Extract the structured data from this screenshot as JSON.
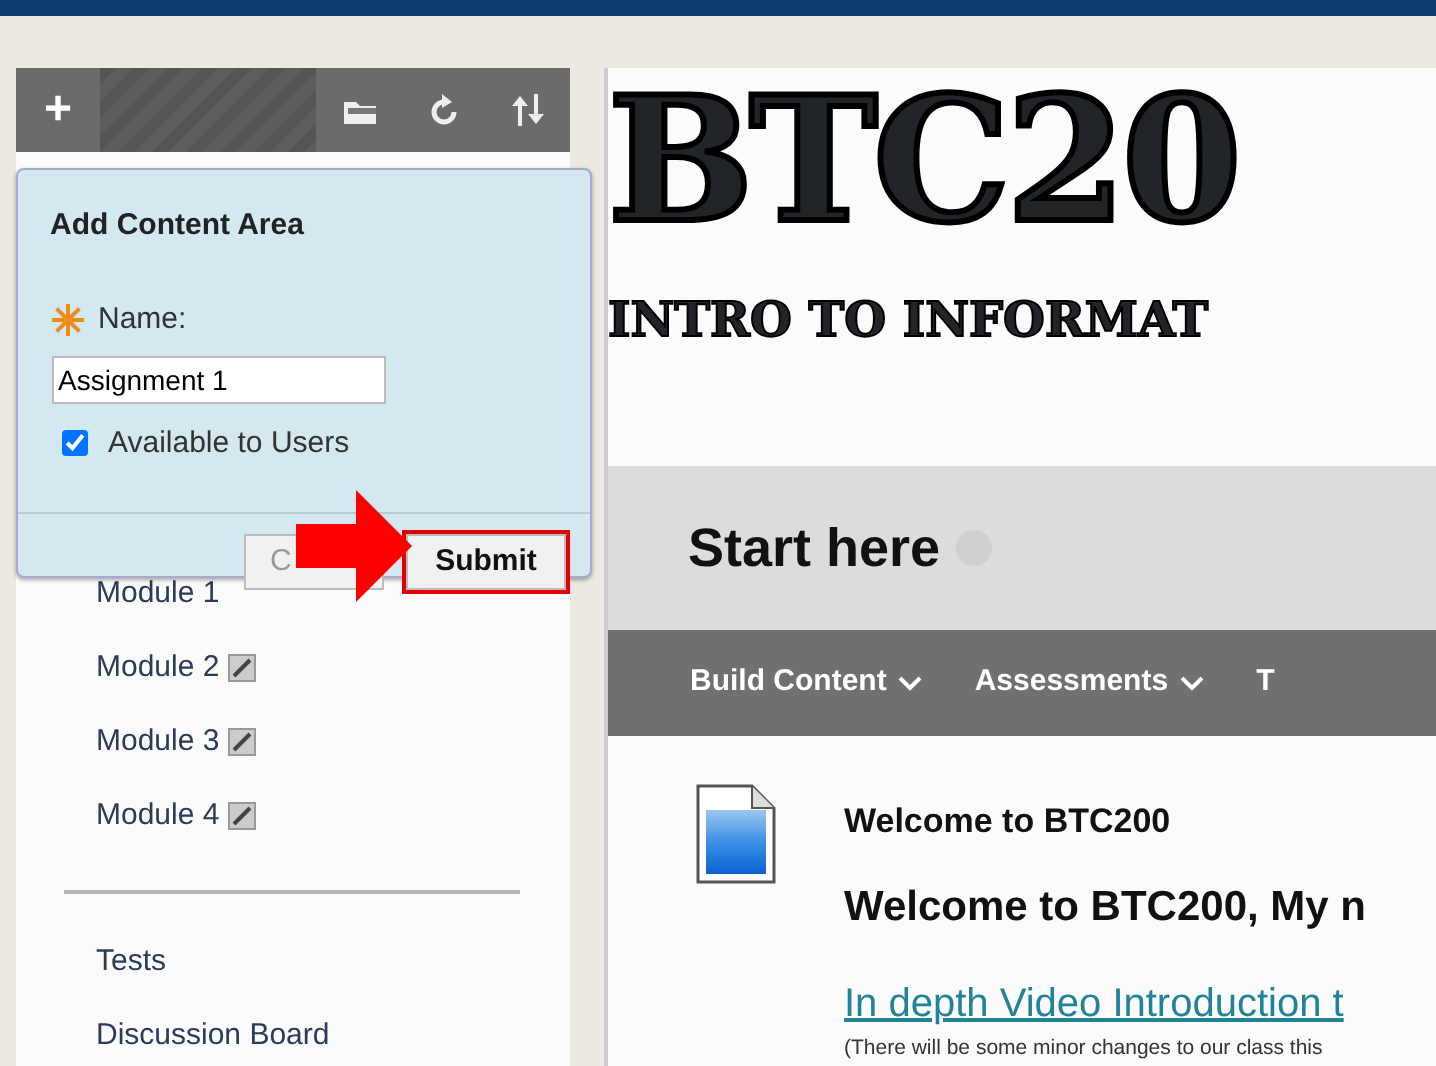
{
  "toolbar": {
    "add_label": "+"
  },
  "popup": {
    "title": "Add Content Area",
    "name_label": "Name:",
    "name_value": "Assignment 1",
    "available": {
      "label": "Available to Users",
      "checked": true
    },
    "buttons": [
      {
        "label": "C",
        "kind": "cancel"
      },
      {
        "label": "Submit",
        "kind": "submit"
      }
    ]
  },
  "sidebar": {
    "groups": [
      [
        {
          "label": "Module 1"
        },
        {
          "label": "Module 2",
          "hidden": true
        },
        {
          "label": "Module 3",
          "hidden": true
        },
        {
          "label": "Module 4",
          "hidden": true
        }
      ],
      [
        {
          "label": "Tests"
        },
        {
          "label": "Discussion Board"
        }
      ]
    ]
  },
  "banner": {
    "title": "BTC20",
    "subtitle": "INTRO TO INFORMAT"
  },
  "page": {
    "title": "Start here"
  },
  "action_bar": [
    {
      "label": "Build Content",
      "caret": true
    },
    {
      "label": "Assessments",
      "caret": true
    },
    {
      "label": "T",
      "caret": false
    }
  ],
  "content_item": {
    "title": "Welcome to BTC200",
    "heading": "Welcome to BTC200, My n",
    "link": "In depth Video Introduction t",
    "note": "(There will be some minor changes to our class this"
  }
}
